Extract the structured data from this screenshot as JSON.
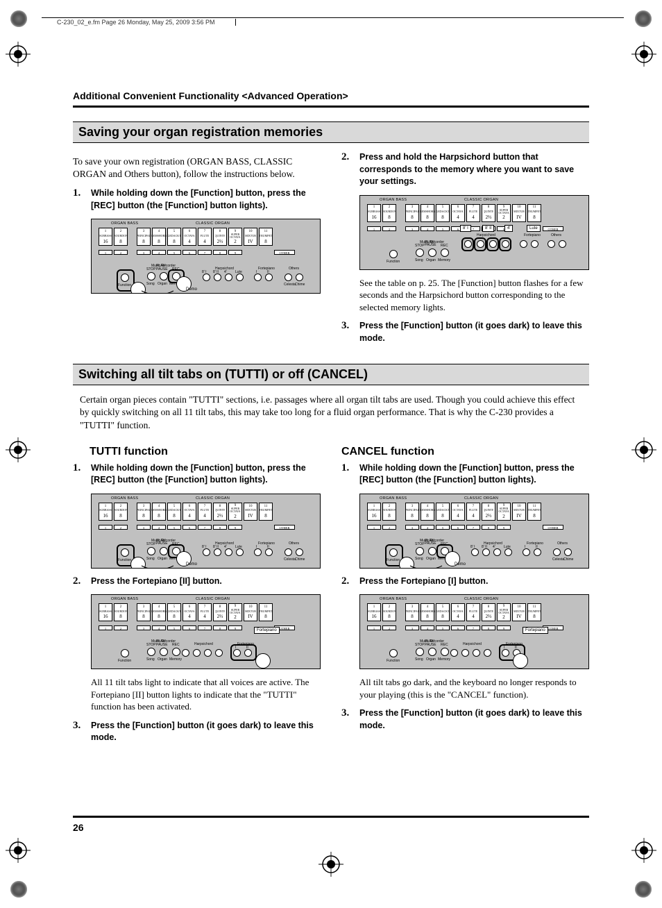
{
  "header_path": "C-230_02_e.fm  Page 26  Monday, May 25, 2009  3:56 PM",
  "section_header": "Additional Convenient Functionality <Advanced Operation>",
  "page_number": "26",
  "heading1": "Saving your organ registration memories",
  "intro1": "To save your own registration (ORGAN BASS, CLASSIC ORGAN and Others button), follow the instructions below.",
  "s1_step1": "While holding down the [Function] button, press the [REC] button (the [Function] button lights).",
  "s1_step2": "Press and hold the Harpsichord button that corresponds to the memory where you want to save your settings.",
  "s1_step2_desc": "See the table on p. 25. The [Function] button flashes for a few seconds and the Harpsichord button corresponding to the selected memory lights.",
  "s1_step3": "Press the [Function] button (it goes dark) to leave this mode.",
  "heading2": "Switching all tilt tabs on (TUTTI) or off (CANCEL)",
  "intro2": "Certain organ pieces contain \"TUTTI\" sections, i.e. passages where all organ tilt tabs are used. Though you could achieve this effect by quickly switching on all 11 tilt tabs, this may take too long for a fluid organ performance. That is why the C-230 provides a \"TUTTI\" function.",
  "tutti_heading": "TUTTI function",
  "t_step1": "While holding down the [Function] button, press the [REC] button (the [Function] button lights).",
  "t_step2": "Press the Fortepiano [II] button.",
  "t_step2_desc": "All 11 tilt tabs light to indicate that all voices are active. The Fortepiano [II] button lights to indicate that the \"TUTTI\" function has been activated.",
  "t_step3": "Press the [Function] button (it goes dark) to leave this mode.",
  "cancel_heading": "CANCEL function",
  "c_step1": "While holding down the [Function] button, press the [REC] button (the [Function] button lights).",
  "c_step2": "Press the Fortepiano [I] button.",
  "c_step2_desc": "All tilt tabs go dark, and the keyboard no longer responds to your playing (this is the \"CANCEL\" function).",
  "c_step3": "Press the [Function] button (it goes dark) to leave this mode.",
  "fig": {
    "organ_bass": "ORGAN BASS",
    "classic_organ": "CLASSIC ORGAN",
    "bass_tabs": [
      {
        "n": "1",
        "lab": "SUBBASS",
        "v": "16"
      },
      {
        "n": "2",
        "lab": "BOURDON",
        "v": "8"
      }
    ],
    "classic_tabs": [
      {
        "n": "3",
        "lab": "PRINCIPAL",
        "v": "8"
      },
      {
        "n": "4",
        "lab": "GEMSHORN",
        "v": "8"
      },
      {
        "n": "5",
        "lab": "GEDACKT",
        "v": "8"
      },
      {
        "n": "6",
        "lab": "OCTAVA",
        "v": "4"
      },
      {
        "n": "7",
        "lab": "FLUTE",
        "v": "4"
      },
      {
        "n": "8",
        "lab": "QUINTE",
        "v": "2⅔"
      },
      {
        "n": "9",
        "lab": "SUPER OCTAVA",
        "v": "2"
      },
      {
        "n": "10",
        "lab": "MIXTUR",
        "v": "IV"
      },
      {
        "n": "11",
        "lab": "TRUMPET",
        "v": "8"
      }
    ],
    "slim_bass": [
      "1",
      "2"
    ],
    "slim_classic": [
      "3",
      "4",
      "5",
      "6",
      "7",
      "8",
      "9"
    ],
    "slim_other": "OTHER",
    "music_recorder": "Music Recorder",
    "stop": "STOP",
    "play_pause": "PLAY/\nPAUSE",
    "rec": "REC",
    "function": "Function",
    "song": "Song",
    "organ": "Organ",
    "memory": "Memory",
    "demo": "Demo",
    "harpsichord": "Harpsichord",
    "fortepiano": "Fortepiano",
    "others": "Others",
    "lute": "Lute",
    "celesta": "Celesta",
    "chime": "Chime",
    "harp_labels": [
      "8' I",
      "8' II",
      "4'",
      "Lute"
    ],
    "fp_labels": [
      "I",
      "II"
    ],
    "others_nums": [
      "1",
      "2"
    ],
    "tab_callout_fp": "Fortepiano",
    "callout_hp": [
      "8' I",
      "8' II",
      "4'",
      "Lute"
    ]
  }
}
